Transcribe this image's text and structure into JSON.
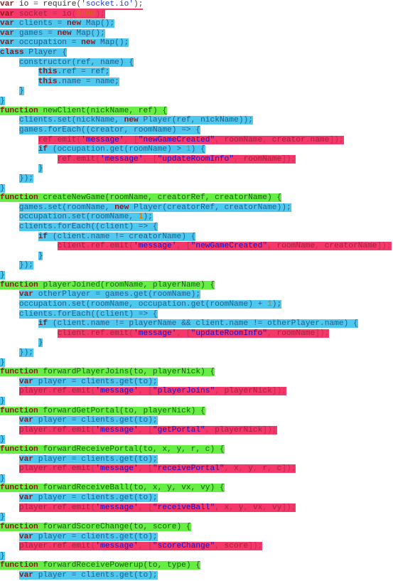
{
  "editor": {
    "language": "javascript",
    "filename_hint": "socket server code",
    "colors": {
      "background": "#ffffff",
      "highlight_cyan": "#4fc8f0",
      "highlight_pink": "#f5386a",
      "highlight_green": "#66ee44",
      "keyword": "#8b1a1a",
      "string": "#1a3fd0",
      "number": "#d07000",
      "plain_text": "#333333"
    },
    "total_lines": 59
  },
  "code_lines": [
    {
      "n": 1,
      "indent": 0,
      "hl": "none",
      "text": "var io = require('socket.io');",
      "underline": true
    },
    {
      "n": 2,
      "indent": 0,
      "hl": "pink",
      "text": "var socket = io(8000);"
    },
    {
      "n": 3,
      "indent": 0,
      "hl": "cyan",
      "text": "var clients = new Map();"
    },
    {
      "n": 4,
      "indent": 0,
      "hl": "cyan",
      "text": "var games = new Map();"
    },
    {
      "n": 5,
      "indent": 0,
      "hl": "cyan",
      "text": "var occupation = new Map();"
    },
    {
      "n": 6,
      "indent": 0,
      "hl": "cyan",
      "text": "class Player {"
    },
    {
      "n": 7,
      "indent": 4,
      "hl": "cyan",
      "text": "constructor(ref, name) {"
    },
    {
      "n": 8,
      "indent": 8,
      "hl": "cyan",
      "text": "this.ref = ref;"
    },
    {
      "n": 9,
      "indent": 8,
      "hl": "cyan",
      "text": "this.name = name;"
    },
    {
      "n": 10,
      "indent": 4,
      "hl": "cyan",
      "text": "}"
    },
    {
      "n": 11,
      "indent": 0,
      "hl": "cyan",
      "text": "}"
    },
    {
      "n": 12,
      "indent": 0,
      "hl": "green",
      "text": "function newClient(nickName, ref) {"
    },
    {
      "n": 13,
      "indent": 4,
      "hl": "cyan",
      "text": "clients.set(nickName, new Player(ref, nickName));"
    },
    {
      "n": 14,
      "indent": 4,
      "hl": "cyan",
      "text": "games.forEach((creator, roomName) => {"
    },
    {
      "n": 15,
      "indent": 8,
      "hl": "pink",
      "text": "ref.emit('message', [\"newGameCreated\", roomName, creator.name]);"
    },
    {
      "n": 16,
      "indent": 8,
      "hl": "cyan",
      "text": "if (occupation.get(roomName) > 1) {"
    },
    {
      "n": 17,
      "indent": 12,
      "hl": "pink",
      "text": "ref.emit('message', [\"updateRoomInfo\", roomName]);"
    },
    {
      "n": 18,
      "indent": 8,
      "hl": "cyan",
      "text": "}"
    },
    {
      "n": 19,
      "indent": 4,
      "hl": "cyan",
      "text": "});"
    },
    {
      "n": 20,
      "indent": 0,
      "hl": "cyan",
      "text": "}"
    },
    {
      "n": 21,
      "indent": 0,
      "hl": "green",
      "text": "function createNewGame(roomName, creatorRef, creatorName) {"
    },
    {
      "n": 22,
      "indent": 4,
      "hl": "cyan",
      "text": "games.set(roomName, new Player(creatorRef, creatorName));"
    },
    {
      "n": 23,
      "indent": 4,
      "hl": "cyan",
      "text": "occupation.set(roomName, 1);"
    },
    {
      "n": 24,
      "indent": 4,
      "hl": "cyan",
      "text": "clients.forEach((client) => {"
    },
    {
      "n": 25,
      "indent": 8,
      "hl": "cyan",
      "text": "if (client.name != creatorName) {"
    },
    {
      "n": 26,
      "indent": 12,
      "hl": "pink",
      "text": "client.ref.emit('message', [\"newGameCreated\", roomName, creatorName]);"
    },
    {
      "n": 27,
      "indent": 8,
      "hl": "cyan",
      "text": "}"
    },
    {
      "n": 28,
      "indent": 4,
      "hl": "cyan",
      "text": "});"
    },
    {
      "n": 29,
      "indent": 0,
      "hl": "cyan",
      "text": "}"
    },
    {
      "n": 30,
      "indent": 0,
      "hl": "green",
      "text": "function playerJoined(roomName, playerName) {"
    },
    {
      "n": 31,
      "indent": 4,
      "hl": "cyan",
      "text": "var otherPlayer = games.get(roomName);"
    },
    {
      "n": 32,
      "indent": 4,
      "hl": "cyan",
      "text": "occupation.set(roomName, occupation.get(roomName) + 1);"
    },
    {
      "n": 33,
      "indent": 4,
      "hl": "cyan",
      "text": "clients.forEach((client) => {"
    },
    {
      "n": 34,
      "indent": 8,
      "hl": "cyan",
      "text": "if (client.name != playerName && client.name != otherPlayer.name) {"
    },
    {
      "n": 35,
      "indent": 12,
      "hl": "pink",
      "text": "client.ref.emit('message', [\"updateRoomInfo\", roomName]);"
    },
    {
      "n": 36,
      "indent": 8,
      "hl": "cyan",
      "text": "}"
    },
    {
      "n": 37,
      "indent": 4,
      "hl": "cyan",
      "text": "});"
    },
    {
      "n": 38,
      "indent": 0,
      "hl": "cyan",
      "text": "}"
    },
    {
      "n": 39,
      "indent": 0,
      "hl": "green",
      "text": "function forwardPlayerJoins(to, playerNick) {"
    },
    {
      "n": 40,
      "indent": 4,
      "hl": "cyan",
      "text": "var player = clients.get(to);"
    },
    {
      "n": 41,
      "indent": 4,
      "hl": "pink",
      "text": "player.ref.emit('message', [\"playerJoins\", playerNick]);"
    },
    {
      "n": 42,
      "indent": 0,
      "hl": "cyan",
      "text": "}"
    },
    {
      "n": 43,
      "indent": 0,
      "hl": "green",
      "text": "function forwardGetPortal(to, playerNick) {"
    },
    {
      "n": 44,
      "indent": 4,
      "hl": "cyan",
      "text": "var player = clients.get(to);"
    },
    {
      "n": 45,
      "indent": 4,
      "hl": "pink",
      "text": "player.ref.emit('message', [\"getPortal\", playerNick]);"
    },
    {
      "n": 46,
      "indent": 0,
      "hl": "cyan",
      "text": "}"
    },
    {
      "n": 47,
      "indent": 0,
      "hl": "green",
      "text": "function forwardReceivePortal(to, x, y, r, c) {"
    },
    {
      "n": 48,
      "indent": 4,
      "hl": "cyan",
      "text": "var player = clients.get(to);"
    },
    {
      "n": 49,
      "indent": 4,
      "hl": "pink",
      "text": "player.ref.emit('message', [\"receivePortal\", x, y, r, c]);"
    },
    {
      "n": 50,
      "indent": 0,
      "hl": "cyan",
      "text": "}"
    },
    {
      "n": 51,
      "indent": 0,
      "hl": "green",
      "text": "function forwardReceiveBall(to, x, y, vx, vy) {"
    },
    {
      "n": 52,
      "indent": 4,
      "hl": "cyan",
      "text": "var player = clients.get(to);"
    },
    {
      "n": 53,
      "indent": 4,
      "hl": "pink",
      "text": "player.ref.emit('message', [\"receiveBall\", x, y, vx, vy]);"
    },
    {
      "n": 54,
      "indent": 0,
      "hl": "cyan",
      "text": "}"
    },
    {
      "n": 55,
      "indent": 0,
      "hl": "green",
      "text": "function forwardScoreChange(to, score) {"
    },
    {
      "n": 56,
      "indent": 4,
      "hl": "cyan",
      "text": "var player = clients.get(to);"
    },
    {
      "n": 57,
      "indent": 4,
      "hl": "pink",
      "text": "player.ref.emit('message', [\"scoreChange\", score]);"
    },
    {
      "n": 58,
      "indent": 0,
      "hl": "cyan",
      "text": "}"
    },
    {
      "n": 59,
      "indent": 0,
      "hl": "green",
      "text": "function forwardReceivePowerup(to, type) {"
    },
    {
      "n": 60,
      "indent": 4,
      "hl": "cyan",
      "text": "var player = clients.get(to);"
    }
  ]
}
